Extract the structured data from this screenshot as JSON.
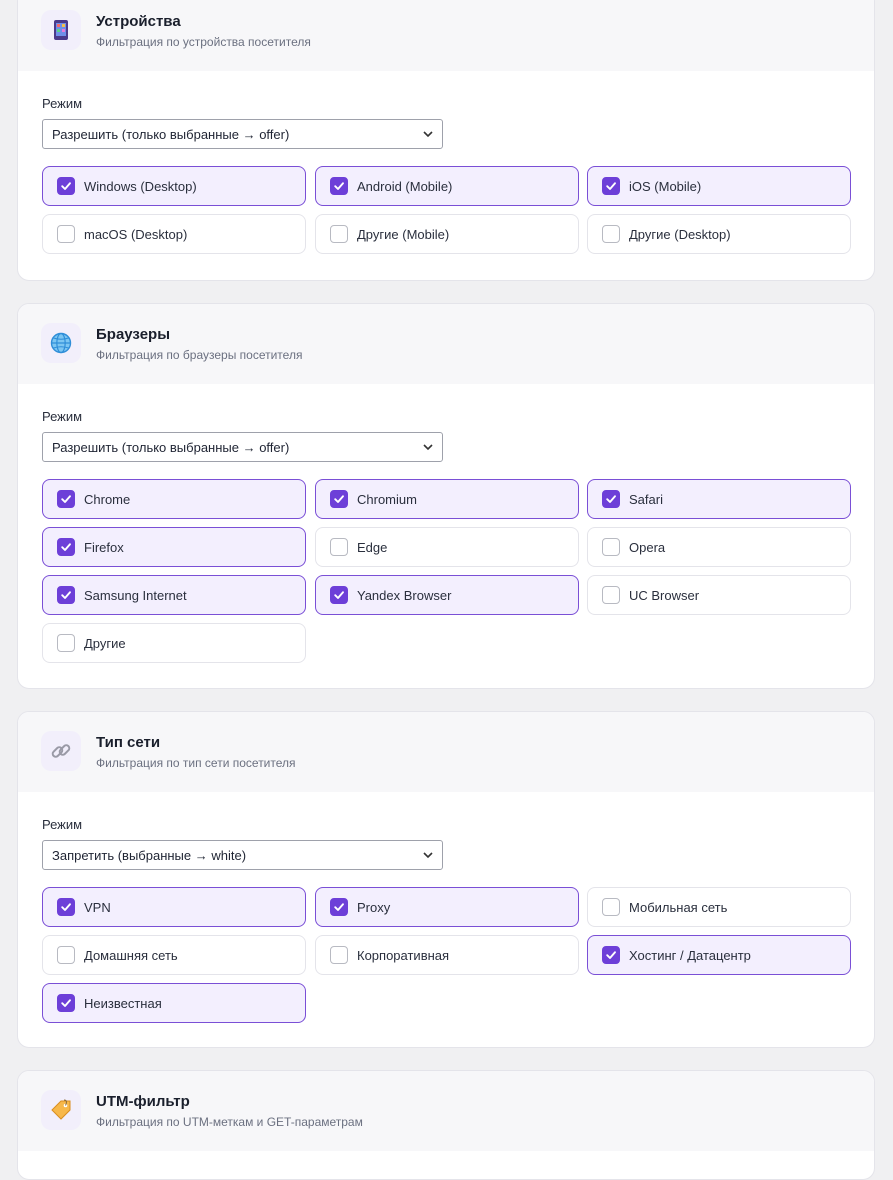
{
  "sections": [
    {
      "title": "Устройства",
      "subtitle": "Фильтрация по устройства посетителя",
      "icon": "phone-icon",
      "mode_label": "Режим",
      "mode_value": "Разрешить (только выбранные → offer)",
      "options": [
        {
          "label": "Windows (Desktop)",
          "checked": true
        },
        {
          "label": "Android (Mobile)",
          "checked": true
        },
        {
          "label": "iOS (Mobile)",
          "checked": true
        },
        {
          "label": "macOS (Desktop)",
          "checked": false
        },
        {
          "label": "Другие (Mobile)",
          "checked": false
        },
        {
          "label": "Другие (Desktop)",
          "checked": false
        }
      ]
    },
    {
      "title": "Браузеры",
      "subtitle": "Фильтрация по браузеры посетителя",
      "icon": "globe-icon",
      "mode_label": "Режим",
      "mode_value": "Разрешить (только выбранные → offer)",
      "options": [
        {
          "label": "Chrome",
          "checked": true
        },
        {
          "label": "Chromium",
          "checked": true
        },
        {
          "label": "Safari",
          "checked": true
        },
        {
          "label": "Firefox",
          "checked": true
        },
        {
          "label": "Edge",
          "checked": false
        },
        {
          "label": "Opera",
          "checked": false
        },
        {
          "label": "Samsung Internet",
          "checked": true
        },
        {
          "label": "Yandex Browser",
          "checked": true
        },
        {
          "label": "UC Browser",
          "checked": false
        },
        {
          "label": "Другие",
          "checked": false
        }
      ]
    },
    {
      "title": "Тип сети",
      "subtitle": "Фильтрация по тип сети посетителя",
      "icon": "link-icon",
      "mode_label": "Режим",
      "mode_value": "Запретить (выбранные → white)",
      "options": [
        {
          "label": "VPN",
          "checked": true
        },
        {
          "label": "Proxy",
          "checked": true
        },
        {
          "label": "Мобильная сеть",
          "checked": false
        },
        {
          "label": "Домашняя сеть",
          "checked": false
        },
        {
          "label": "Корпоративная",
          "checked": false
        },
        {
          "label": "Хостинг / Датацентр",
          "checked": true
        },
        {
          "label": "Неизвестная",
          "checked": true
        }
      ]
    },
    {
      "title": "UTM-фильтр",
      "subtitle": "Фильтрация по UTM-меткам и GET-параметрам",
      "icon": "tag-icon"
    }
  ]
}
